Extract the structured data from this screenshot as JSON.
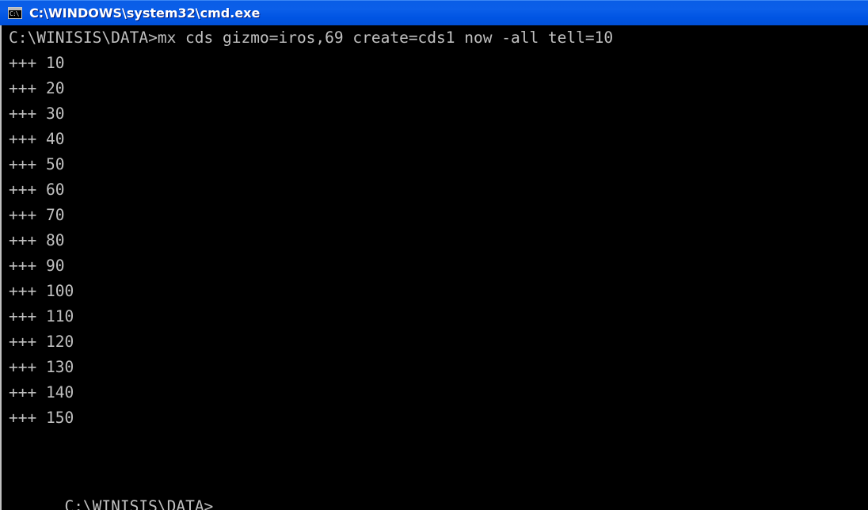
{
  "window": {
    "title": "C:\\WINDOWS\\system32\\cmd.exe",
    "icon": "cmd-console-icon",
    "icon_glyph": "C:\\"
  },
  "console": {
    "command_line": "C:\\WINISIS\\DATA>mx cds gizmo=iros,69 create=cds1 now -all tell=10",
    "output": [
      "+++ 10",
      "+++ 20",
      "+++ 30",
      "+++ 40",
      "+++ 50",
      "+++ 60",
      "+++ 70",
      "+++ 80",
      "+++ 90",
      "+++ 100",
      "+++ 110",
      "+++ 120",
      "+++ 130",
      "+++ 140",
      "+++ 150"
    ],
    "prompt": "C:\\WINISIS\\DATA>"
  },
  "colors": {
    "titlebar": "#0054e3",
    "console_bg": "#000000",
    "console_text": "#c0c0c0"
  }
}
